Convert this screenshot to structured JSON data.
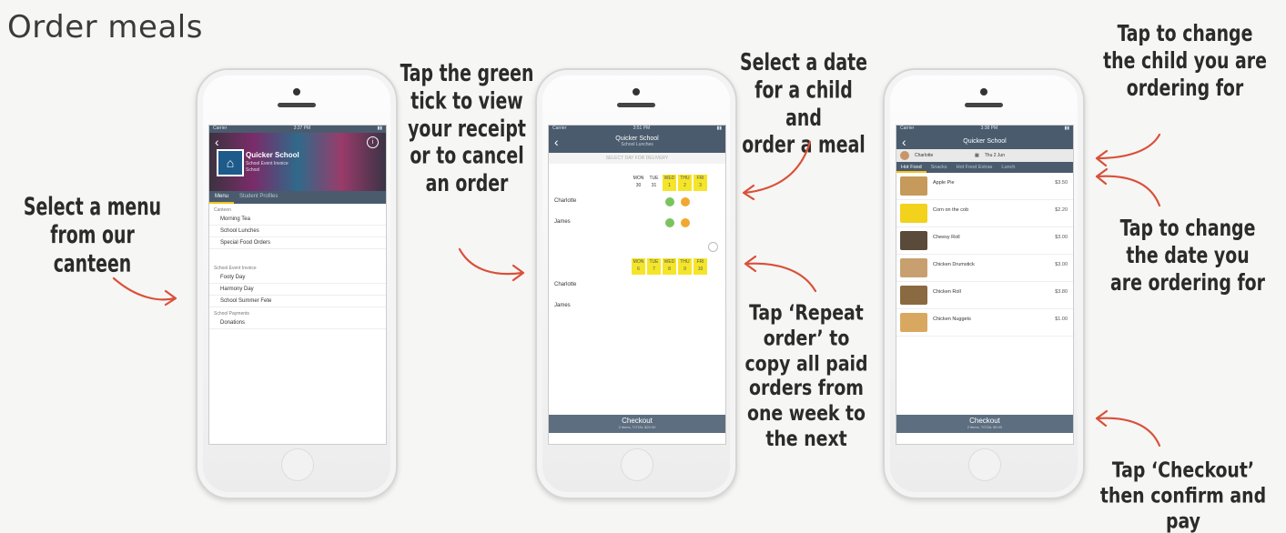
{
  "title": "Order meals",
  "captions": {
    "select_menu": "Select a menu\nfrom our canteen",
    "green_tick": "Tap the green\ntick to view\nyour receipt\nor to cancel\nan order",
    "select_date": "Select a date\nfor a child and\norder a meal",
    "repeat_order": "Tap ‘Repeat\norder’ to\ncopy all paid\norders from\none week to\nthe next",
    "change_child": "Tap to change\nthe child you are\nordering for",
    "change_date": "Tap to change\nthe date you\nare ordering for",
    "checkout": "Tap ‘Checkout’\nthen confirm and pay"
  },
  "phone1": {
    "status_left": "Carrier",
    "status_time": "3:37 PM",
    "school_name": "Quicker School",
    "school_sub": "School Event Invoice",
    "school_sub2": "School",
    "tabs": [
      "Menu",
      "Student Profiles"
    ],
    "section_canteen": "Canteen",
    "canteen_items": [
      "Morning Tea",
      "School Lunches",
      "Special Food Orders"
    ],
    "section_events": "School Event Invoice",
    "event_items": [
      "Footy Day",
      "Harmony Day",
      "School Summer Fete"
    ],
    "section_payments": "School Payments",
    "payment_items": [
      "Donations"
    ]
  },
  "phone2": {
    "status_time": "3:51 PM",
    "nav_title": "Quicker School",
    "nav_sub": "School Lunches",
    "select_day": "SELECT DAY FOR DELIVERY",
    "week1_days": [
      "MON",
      "TUE",
      "WED",
      "THU",
      "FRI"
    ],
    "week1_dates": [
      "30",
      "31",
      "1",
      "2",
      "3"
    ],
    "week2_days": [
      "MON",
      "TUE",
      "WED",
      "THU",
      "FRI"
    ],
    "week2_dates": [
      "6",
      "7",
      "8",
      "9",
      "10"
    ],
    "children": [
      "Charlotte",
      "James"
    ],
    "checkout": "Checkout",
    "checkout_sub": "2 items, TOTAL $20.00"
  },
  "phone3": {
    "status_time": "3:38 PM",
    "nav_title": "Quicker School",
    "child": "Charlotte",
    "date": "Thu 2 Jun",
    "tabs": [
      "Hot Food",
      "Snacks",
      "Hot Food Extras",
      "Lunch"
    ],
    "foods": [
      {
        "name": "Apple Pie",
        "price": "$3.50"
      },
      {
        "name": "Corn on the cob",
        "price": "$2.20"
      },
      {
        "name": "Cheesy Roll",
        "price": "$3.00"
      },
      {
        "name": "Chicken Drumstick",
        "price": "$3.00"
      },
      {
        "name": "Chicken Roll",
        "price": "$3.80"
      },
      {
        "name": "Chicken Nuggets",
        "price": "$1.00"
      }
    ],
    "checkout": "Checkout",
    "checkout_sub": "2 items, TOTAL $9.00"
  },
  "colors": {
    "accent_arrow": "#d9503a",
    "nav": "#4a5b6e",
    "highlight": "#f5e52a",
    "green": "#7cc35e",
    "orange": "#f0a830"
  }
}
